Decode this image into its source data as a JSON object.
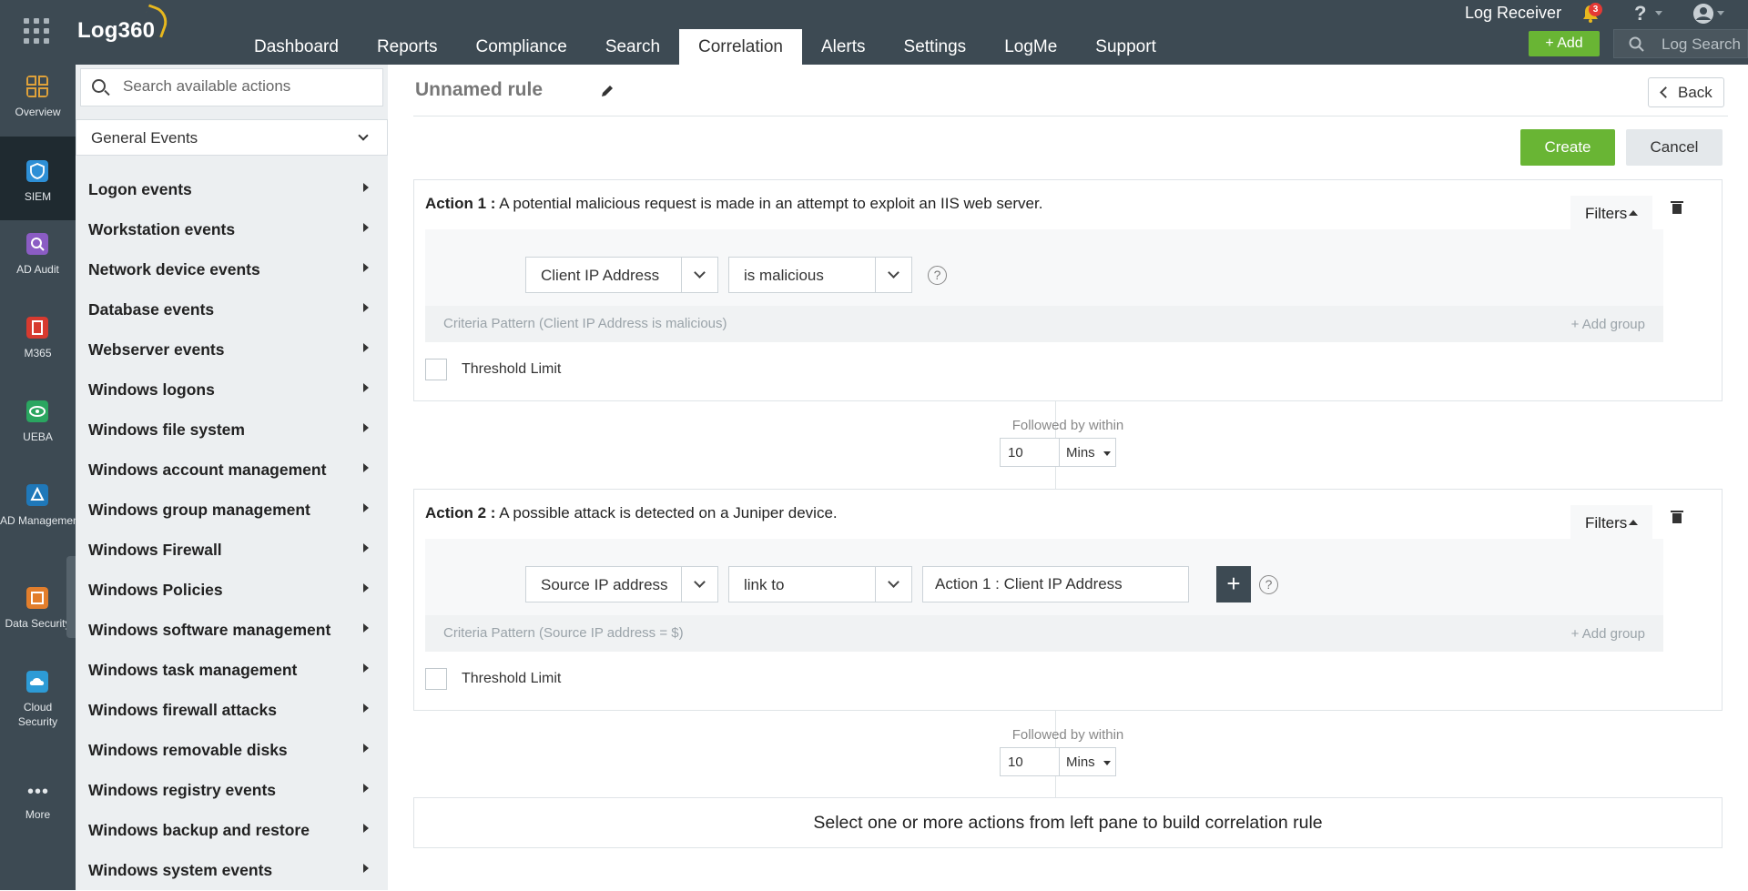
{
  "topbar": {
    "logo": "Log360",
    "nav": [
      "Dashboard",
      "Reports",
      "Compliance",
      "Search",
      "Correlation",
      "Alerts",
      "Settings",
      "LogMe",
      "Support"
    ],
    "active_nav": "Correlation",
    "log_receiver": "Log Receiver",
    "notification_count": "3",
    "help_label": "?",
    "add_label": "+ Add",
    "log_search_placeholder": "Log Search"
  },
  "appbar": {
    "items": [
      {
        "label": "Overview",
        "icon": "overview-icon",
        "color": "#e0a23a"
      },
      {
        "label": "SIEM",
        "icon": "siem-icon",
        "color": "#2d8fd6"
      },
      {
        "label": "AD Audit",
        "icon": "ad-audit-icon",
        "color": "#8b5cc4"
      },
      {
        "label": "M365",
        "icon": "m365-icon",
        "color": "#d73a2f"
      },
      {
        "label": "UEBA",
        "icon": "ueba-icon",
        "color": "#2aa660"
      },
      {
        "label": "AD Managemen",
        "icon": "ad-management-icon",
        "color": "#1f78b9"
      },
      {
        "label": "Data Security",
        "icon": "data-security-icon",
        "color": "#e27e2c"
      },
      {
        "label": "Cloud Security",
        "icon": "cloud-security-icon",
        "color": "#2d9bd6"
      },
      {
        "label": "More",
        "icon": "more-icon",
        "color": "#cfd5d9"
      }
    ]
  },
  "actions_pane": {
    "search_placeholder": "Search available actions",
    "category": "General Events",
    "items": [
      "Logon events",
      "Workstation events",
      "Network device events",
      "Database events",
      "Webserver events",
      "Windows logons",
      "Windows file system",
      "Windows account management",
      "Windows group management",
      "Windows Firewall",
      "Windows Policies",
      "Windows software management",
      "Windows task management",
      "Windows firewall attacks",
      "Windows removable disks",
      "Windows registry events",
      "Windows backup and restore",
      "Windows system events"
    ]
  },
  "main": {
    "rule_title": "Unnamed rule",
    "back_label": "Back",
    "create_label": "Create",
    "cancel_label": "Cancel",
    "filters_label": "Filters",
    "add_group_label": "+ Add group",
    "threshold_label": "Threshold Limit",
    "followed_label": "Followed by within",
    "action1": {
      "prefix": "Action 1 :",
      "description": " A potential malicious request is made in an attempt to exploit an IIS web server.",
      "field": "Client IP Address",
      "operator": "is malicious",
      "criteria": "Criteria Pattern (Client IP Address is malicious)"
    },
    "follow1": {
      "value": "10",
      "unit": "Mins"
    },
    "action2": {
      "prefix": "Action 2 :",
      "description": " A possible attack is detected on a Juniper device.",
      "field": "Source IP address",
      "operator": "link to",
      "value": "Action 1 : Client IP Address",
      "criteria": "Criteria Pattern (Source IP address = $)"
    },
    "follow2": {
      "value": "10",
      "unit": "Mins"
    },
    "hint": "Select one or more actions from left pane to build correlation rule"
  }
}
